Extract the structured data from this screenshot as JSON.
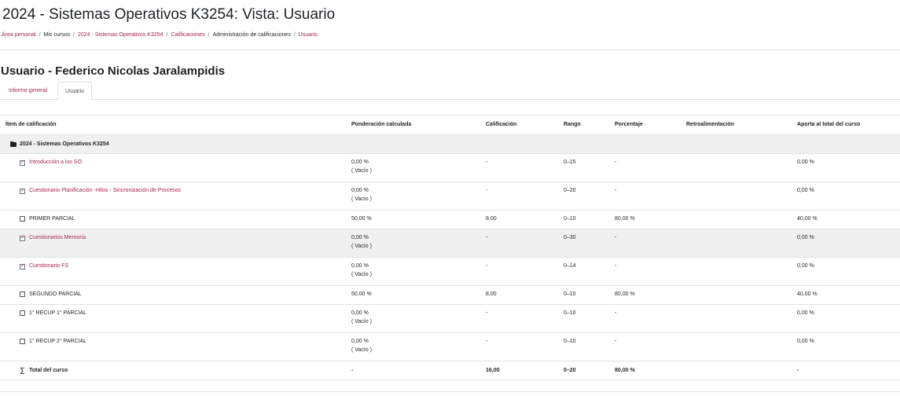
{
  "page": {
    "title": "2024 - Sistemas Operativos K3254: Vista: Usuario"
  },
  "breadcrumb": [
    {
      "label": "Área personal",
      "link": true
    },
    {
      "label": "Mis cursos",
      "link": false
    },
    {
      "label": "2024 - Sistemas Operativos K3254",
      "link": true
    },
    {
      "label": "Calificaciones",
      "link": true
    },
    {
      "label": "Administración de calificaciones",
      "link": false
    },
    {
      "label": "Usuario",
      "link": true
    }
  ],
  "user_heading": "Usuario - Federico Nicolas Jaralampidis",
  "tabs": [
    {
      "label": "Informe general",
      "active": false
    },
    {
      "label": "Usuario",
      "active": true
    }
  ],
  "table": {
    "headers": {
      "item": "Ítem de calificación",
      "pond": "Ponderación calculada",
      "calif": "Calificación",
      "rango": "Rango",
      "porc": "Porcentaje",
      "retro": "Retroalimentación",
      "aporta": "Aporta al total del curso"
    },
    "category": "2024 - Sistemas Operativos K3254",
    "rows": [
      {
        "name": "Introducción a los SO",
        "icon": "quiz-icon",
        "pond": "0,00 %",
        "pond_sub": "( Vacío )",
        "calif": "-",
        "rango": "0–15",
        "porc": "-",
        "retro": "",
        "aporta": "0,00 %"
      },
      {
        "name": "Cuestionario Planificación -Hilos - Sincronización de Procesos",
        "icon": "quiz-icon",
        "pond": "0,00 %",
        "pond_sub": "( Vacío )",
        "calif": "-",
        "rango": "0–20",
        "porc": "-",
        "retro": "",
        "aporta": "0,00 %"
      },
      {
        "name": "PRIMER PARCIAL",
        "icon": "manual-item-icon",
        "pond": "50,00 %",
        "pond_sub": "",
        "calif": "8,00",
        "rango": "0–10",
        "porc": "80,00 %",
        "retro": "",
        "aporta": "40,00 %"
      },
      {
        "name": "Cuestionarios Memoria",
        "icon": "quiz-icon",
        "pond": "0,00 %",
        "pond_sub": "( Vacío )",
        "calif": "-",
        "rango": "0–30",
        "porc": "-",
        "retro": "",
        "aporta": "0,00 %"
      },
      {
        "name": "Cuestionario FS",
        "icon": "quiz-icon",
        "pond": "0,00 %",
        "pond_sub": "( Vacío )",
        "calif": "-",
        "rango": "0–14",
        "porc": "-",
        "retro": "",
        "aporta": "0,00 %"
      },
      {
        "name": "SEGUNDO PARCIAL",
        "icon": "manual-item-icon",
        "pond": "50,00 %",
        "pond_sub": "",
        "calif": "8,00",
        "rango": "0–10",
        "porc": "80,00 %",
        "retro": "",
        "aporta": "40,00 %"
      },
      {
        "name": "1° RECUP 1° PARCIAL",
        "icon": "manual-item-icon",
        "pond": "0,00 %",
        "pond_sub": "( Vacío )",
        "calif": "-",
        "rango": "0–10",
        "porc": "-",
        "retro": "",
        "aporta": "0,00 %"
      },
      {
        "name": "1° RECUP 2° PARCIAL",
        "icon": "manual-item-icon",
        "pond": "0,00 %",
        "pond_sub": "( Vacío )",
        "calif": "-",
        "rango": "0–10",
        "porc": "-",
        "retro": "",
        "aporta": "0,00 %"
      }
    ],
    "total": {
      "name": "Total del curso",
      "icon": "sigma-icon",
      "pond": "-",
      "calif": "16,00",
      "rango": "0–20",
      "porc": "80,00 %",
      "retro": "",
      "aporta": "-"
    }
  },
  "colors": {
    "link": "#a8254f",
    "text": "#1d2125",
    "border": "#dee2e6",
    "row_shade": "#f0f0f0"
  }
}
